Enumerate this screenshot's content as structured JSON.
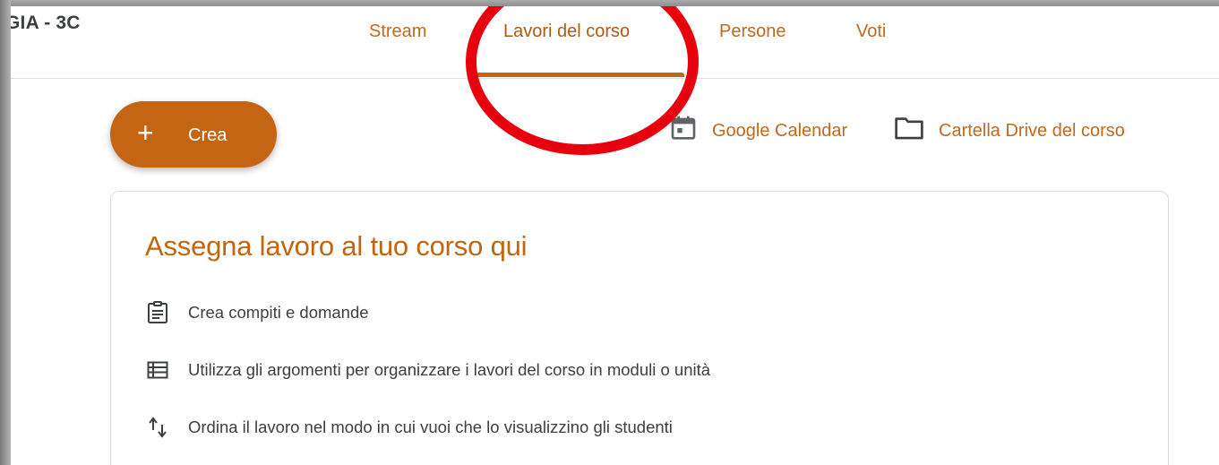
{
  "header": {
    "class_title": "GIA - 3C",
    "tabs": [
      {
        "label": "Stream"
      },
      {
        "label": "Lavori del corso",
        "active": true
      },
      {
        "label": "Persone"
      },
      {
        "label": "Voti"
      }
    ]
  },
  "toolbar": {
    "create_label": "Crea",
    "calendar_label": "Google Calendar",
    "drive_label": "Cartella Drive del corso"
  },
  "card": {
    "title": "Assegna lavoro al tuo corso qui",
    "items": [
      {
        "icon": "assignment-icon",
        "text": "Crea compiti e domande"
      },
      {
        "icon": "topic-list-icon",
        "text": "Utilizza gli argomenti per organizzare i lavori del corso in moduli o unità"
      },
      {
        "icon": "reorder-arrows-icon",
        "text": "Ordina il lavoro nel modo in cui vuoi che lo visualizzino gli studenti"
      }
    ]
  },
  "colors": {
    "accent": "#c5670f",
    "annotation": "#e8000f",
    "text": "#3c4043"
  }
}
